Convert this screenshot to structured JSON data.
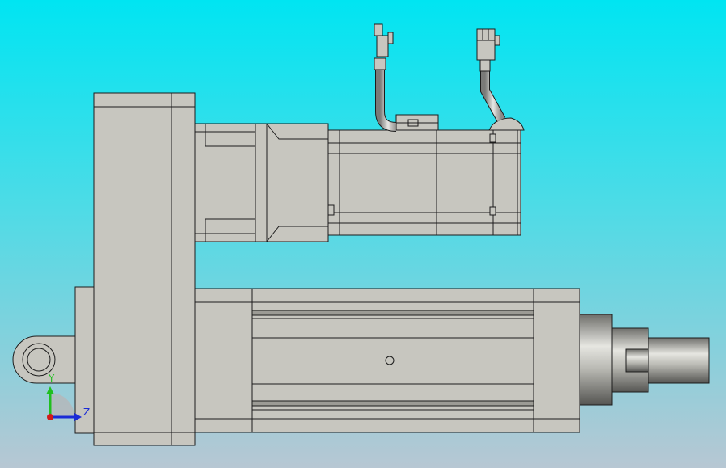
{
  "viewport": {
    "background_top": "#00e5f2",
    "background_bottom": "#b7c7d3"
  },
  "model": {
    "body_color": "#c7c6bf",
    "edge_color": "#1c1c1c",
    "shadow_color": "#8e8d87"
  },
  "triad": {
    "y_label": "Y",
    "z_label": "Z",
    "y_color": "#1fbf1f",
    "z_color": "#1a2bd6",
    "origin_color": "#d11a1a"
  }
}
